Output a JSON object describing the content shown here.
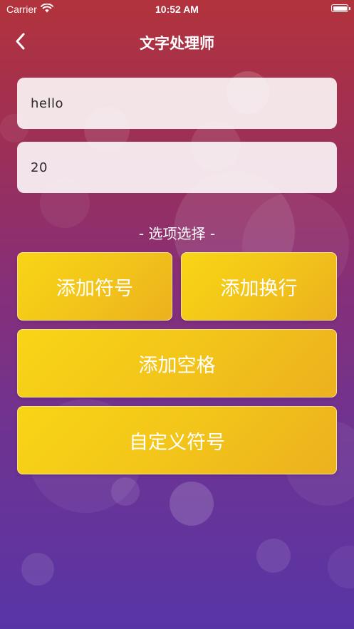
{
  "status_bar": {
    "carrier": "Carrier",
    "time": "10:52 AM"
  },
  "nav": {
    "title": "文字处理师",
    "back_icon": "chevron-left-icon"
  },
  "inputs": {
    "text": {
      "value": "hello"
    },
    "count": {
      "value": "20"
    }
  },
  "options": {
    "label": "- 选项选择 -",
    "add_symbol": "添加符号",
    "add_newline": "添加换行",
    "add_space": "添加空格",
    "custom_symbol": "自定义符号"
  },
  "colors": {
    "button_gold": "#f3c51a",
    "bg_top": "#b2333c",
    "bg_bottom": "#5835a6"
  }
}
